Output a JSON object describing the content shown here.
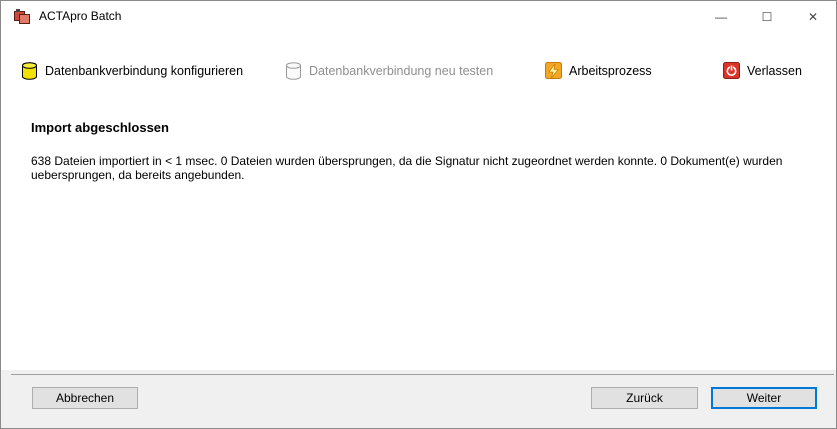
{
  "window": {
    "title": "ACTApro Batch",
    "min_glyph": "—",
    "max_glyph": "☐",
    "close_glyph": "✕"
  },
  "toolbar": {
    "configure_label": "Datenbankverbindung konfigurieren",
    "retest_label": "Datenbankverbindung neu testen",
    "workflow_label": "Arbeitsprozess",
    "exit_label": "Verlassen"
  },
  "content": {
    "heading": "Import abgeschlossen",
    "message": "638 Dateien importiert in < 1 msec. 0 Dateien wurden übersprungen, da die Signatur nicht zugeordnet werden konnte. 0 Dokument(e) wurden uebersprungen, da bereits angebunden."
  },
  "buttons": {
    "cancel_label": "Abbrechen",
    "back_label": "Zurück",
    "next_label": "Weiter"
  },
  "colors": {
    "accent": "#0078d7",
    "database_icon": "#f2e200",
    "workflow_icon": "#f5a623",
    "exit_icon": "#d9352b"
  }
}
